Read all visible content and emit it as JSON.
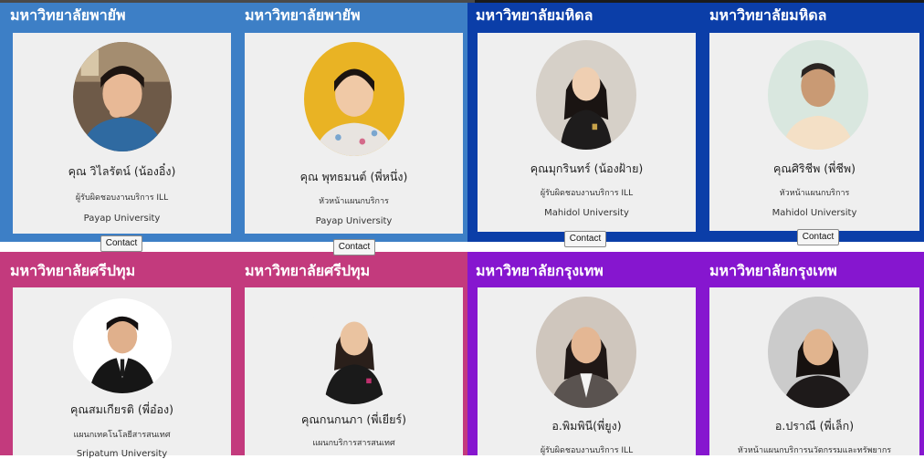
{
  "universities": {
    "payap": "มหาวิทยาลัยพายัพ",
    "mahidol": "มหาวิทยาลัยมหิดล",
    "sripatum": "มหาวิทยาลัยศรีปทุม",
    "bangkok": "มหาวิทยาลัยกรุงเทพ"
  },
  "cards": [
    {
      "name": "คุณ วิไลรัตน์ (น้องอิ๋ง)",
      "role": "ผู้รับผิดชอบงานบริการ ILL",
      "university": "Payap University",
      "contact": "Contact",
      "icon": "person-avatar"
    },
    {
      "name": "คุณ พุทธมนต์ (พี่หนึ่ง)",
      "role": "หัวหน้าแผนกบริการ",
      "university": "Payap University",
      "contact": "Contact",
      "icon": "person-avatar"
    },
    {
      "name": "คุณมุกรินทร์ (น้องฝ้าย)",
      "role": "ผู้รับผิดชอบงานบริการ ILL",
      "university": "Mahidol University",
      "contact": "Contact",
      "icon": "person-avatar"
    },
    {
      "name": "คุณศิริชีพ (พี่ชีพ)",
      "role": "หัวหน้าแผนกบริการ",
      "university": "Mahidol University",
      "contact": "Contact",
      "icon": "person-avatar"
    },
    {
      "name": "คุณสมเกียรติ (พี่อ๋อง)",
      "role": "แผนกเทคโนโลยีสารสนเทศ",
      "university": "Sripatum University",
      "icon": "person-avatar"
    },
    {
      "name": "คุณกนกนภา (พี่เยียร์)",
      "role": "แผนกบริการสารสนเทศ",
      "icon": "person-avatar"
    },
    {
      "name": "อ.พิมพินี(พี่ยูง)",
      "role": "ผู้รับผิดชอบงานบริการ ILL",
      "icon": "person-avatar"
    },
    {
      "name": "อ.ปราณี (พี่เล็ก)",
      "role": "หัวหน้าแผนกบริการนวัตกรรมและทรัพยากร",
      "icon": "person-avatar"
    }
  ],
  "colors": {
    "payap": "#3d7fc6",
    "mahidol": "#0b3ea8",
    "sripatum": "#c33a7d",
    "bangkok": "#8616cf",
    "card": "#efefef"
  }
}
